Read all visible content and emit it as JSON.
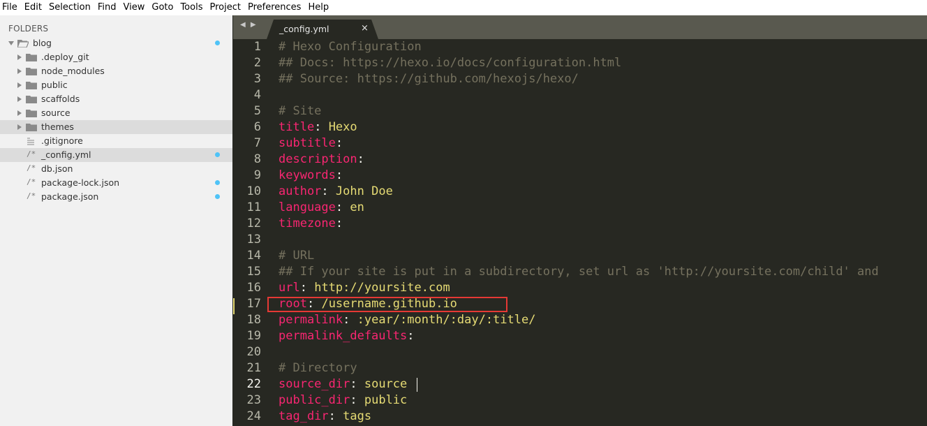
{
  "menu": [
    "File",
    "Edit",
    "Selection",
    "Find",
    "View",
    "Goto",
    "Tools",
    "Project",
    "Preferences",
    "Help"
  ],
  "sidebar": {
    "header": "FOLDERS",
    "items": [
      {
        "label": "blog",
        "type": "folder",
        "expanded": true,
        "level": 0,
        "dot": true
      },
      {
        "label": ".deploy_git",
        "type": "folder",
        "level": 1,
        "dot": false
      },
      {
        "label": "node_modules",
        "type": "folder",
        "level": 1,
        "dot": false
      },
      {
        "label": "public",
        "type": "folder",
        "level": 1,
        "dot": false
      },
      {
        "label": "scaffolds",
        "type": "folder",
        "level": 1,
        "dot": false
      },
      {
        "label": "source",
        "type": "folder",
        "level": 1,
        "dot": false
      },
      {
        "label": "themes",
        "type": "folder",
        "level": 1,
        "dot": false,
        "selected": true
      },
      {
        "label": ".gitignore",
        "type": "file",
        "icon": "lines-icon",
        "level": 1,
        "dot": false
      },
      {
        "label": "_config.yml",
        "type": "file",
        "icon": "/*",
        "level": 1,
        "dot": true,
        "selected": true
      },
      {
        "label": "db.json",
        "type": "file",
        "icon": "/*",
        "level": 1,
        "dot": false
      },
      {
        "label": "package-lock.json",
        "type": "file",
        "icon": "/*",
        "level": 1,
        "dot": true
      },
      {
        "label": "package.json",
        "type": "file",
        "icon": "/*",
        "level": 1,
        "dot": true
      }
    ]
  },
  "tabs": {
    "nav": "◀ ▶",
    "active": "_config.yml",
    "close": "×"
  },
  "editor": {
    "lines": [
      {
        "n": "1",
        "c": "# Hexo Configuration"
      },
      {
        "n": "2",
        "c": "## Docs: https://hexo.io/docs/configuration.html"
      },
      {
        "n": "3",
        "c": "## Source: https://github.com/hexojs/hexo/"
      },
      {
        "n": "4",
        "c": ""
      },
      {
        "n": "5",
        "c": "# Site"
      },
      {
        "n": "6",
        "k": "title",
        "v": "Hexo"
      },
      {
        "n": "7",
        "k": "subtitle",
        "v": ""
      },
      {
        "n": "8",
        "k": "description",
        "v": ""
      },
      {
        "n": "9",
        "k": "keywords",
        "v": ""
      },
      {
        "n": "10",
        "k": "author",
        "v": "John Doe"
      },
      {
        "n": "11",
        "k": "language",
        "v": "en"
      },
      {
        "n": "12",
        "k": "timezone",
        "v": ""
      },
      {
        "n": "13",
        "c": ""
      },
      {
        "n": "14",
        "c": "# URL"
      },
      {
        "n": "15",
        "c": "## If your site is put in a subdirectory, set url as 'http://yoursite.com/child' and"
      },
      {
        "n": "16",
        "k": "url",
        "v": "http://yoursite.com"
      },
      {
        "n": "17",
        "k": "root",
        "v": "/username.github.io"
      },
      {
        "n": "18",
        "k": "permalink",
        "v": ":year/:month/:day/:title/"
      },
      {
        "n": "19",
        "k": "permalink_defaults",
        "v": ""
      },
      {
        "n": "20",
        "c": ""
      },
      {
        "n": "21",
        "c": "# Directory"
      },
      {
        "n": "22",
        "k": "source_dir",
        "v": "source"
      },
      {
        "n": "23",
        "k": "public_dir",
        "v": "public"
      },
      {
        "n": "24",
        "k": "tag_dir",
        "v": "tags"
      }
    ],
    "current_line": "22",
    "modified_line": "17",
    "highlighted_line": "17"
  },
  "colors": {
    "comment": "#75715e",
    "key": "#f92672",
    "value": "#e6db74",
    "highlight_box": "#e53935",
    "modified_dot": "#4fc3f7"
  }
}
